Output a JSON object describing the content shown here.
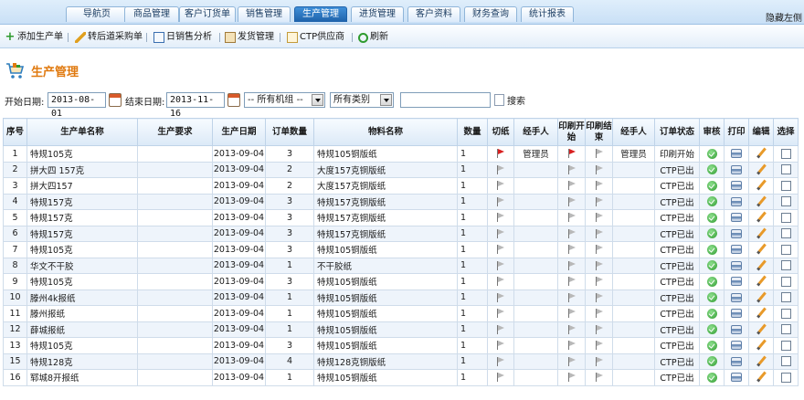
{
  "nav": {
    "tabs": [
      {
        "label": "导航页",
        "active": false
      },
      {
        "label": "商品管理",
        "active": false
      },
      {
        "label": "客户订货单",
        "active": false
      },
      {
        "label": "销售管理",
        "active": false
      },
      {
        "label": "生产管理",
        "active": true
      },
      {
        "label": "进货管理",
        "active": false
      },
      {
        "label": "客户资料",
        "active": false
      },
      {
        "label": "财务查询",
        "active": false
      },
      {
        "label": "统计报表",
        "active": false
      }
    ],
    "right_text": "隐藏左侧"
  },
  "toolbar": {
    "add_label": "添加生产单",
    "transfer_label": "转后道采购单",
    "daily_sales_label": "日销售分析",
    "shipping_label": "发货管理",
    "ctp_label": "CTP供应商",
    "refresh_label": "刷新"
  },
  "page_title": "生产管理",
  "filters": {
    "start_label": "开始日期:",
    "start_value": "2013-08-01",
    "end_label": "结束日期:",
    "end_value": "2013-11-16",
    "org_select": "-- 所有机组 --",
    "category_select": "所有类别",
    "search_value": "",
    "search_label": "搜索"
  },
  "table": {
    "headers": [
      "序号",
      "生产单名称",
      "生产要求",
      "生产日期",
      "订单数量",
      "物料名称",
      "数量",
      "切纸",
      "经手人",
      "印刷开始",
      "印刷结束",
      "经手人",
      "订单状态",
      "审核",
      "打印",
      "编辑",
      "选择"
    ],
    "rows": [
      {
        "no": "1",
        "name": "特规105克",
        "req": "",
        "date": "2013-09-04",
        "qty": "3",
        "material": "特规105铜版纸",
        "count": "1",
        "cut_flag": "red",
        "handler": "管理员",
        "print_start_flag": "red",
        "print_end_flag": "grey",
        "handler2": "管理员",
        "status": "印刷开始"
      },
      {
        "no": "2",
        "name": "拼大四 157克",
        "req": "",
        "date": "2013-09-04",
        "qty": "2",
        "material": "大度157克铜版纸",
        "count": "1",
        "cut_flag": "grey",
        "handler": "",
        "print_start_flag": "grey",
        "print_end_flag": "grey",
        "handler2": "",
        "status": "CTP已出"
      },
      {
        "no": "3",
        "name": "拼大四157",
        "req": "",
        "date": "2013-09-04",
        "qty": "2",
        "material": "大度157克铜版纸",
        "count": "1",
        "cut_flag": "grey",
        "handler": "",
        "print_start_flag": "grey",
        "print_end_flag": "grey",
        "handler2": "",
        "status": "CTP已出"
      },
      {
        "no": "4",
        "name": "特规157克",
        "req": "",
        "date": "2013-09-04",
        "qty": "3",
        "material": "特规157克铜版纸",
        "count": "1",
        "cut_flag": "grey",
        "handler": "",
        "print_start_flag": "grey",
        "print_end_flag": "grey",
        "handler2": "",
        "status": "CTP已出"
      },
      {
        "no": "5",
        "name": "特规157克",
        "req": "",
        "date": "2013-09-04",
        "qty": "3",
        "material": "特规157克铜版纸",
        "count": "1",
        "cut_flag": "grey",
        "handler": "",
        "print_start_flag": "grey",
        "print_end_flag": "grey",
        "handler2": "",
        "status": "CTP已出"
      },
      {
        "no": "6",
        "name": "特规157克",
        "req": "",
        "date": "2013-09-04",
        "qty": "3",
        "material": "特规157克铜版纸",
        "count": "1",
        "cut_flag": "grey",
        "handler": "",
        "print_start_flag": "grey",
        "print_end_flag": "grey",
        "handler2": "",
        "status": "CTP已出"
      },
      {
        "no": "7",
        "name": "特规105克",
        "req": "",
        "date": "2013-09-04",
        "qty": "3",
        "material": "特规105铜版纸",
        "count": "1",
        "cut_flag": "grey",
        "handler": "",
        "print_start_flag": "grey",
        "print_end_flag": "grey",
        "handler2": "",
        "status": "CTP已出"
      },
      {
        "no": "8",
        "name": "华文不干胶",
        "req": "",
        "date": "2013-09-04",
        "qty": "1",
        "material": "不干胶纸",
        "count": "1",
        "cut_flag": "grey",
        "handler": "",
        "print_start_flag": "grey",
        "print_end_flag": "grey",
        "handler2": "",
        "status": "CTP已出"
      },
      {
        "no": "9",
        "name": "特规105克",
        "req": "",
        "date": "2013-09-04",
        "qty": "3",
        "material": "特规105铜版纸",
        "count": "1",
        "cut_flag": "grey",
        "handler": "",
        "print_start_flag": "grey",
        "print_end_flag": "grey",
        "handler2": "",
        "status": "CTP已出"
      },
      {
        "no": "10",
        "name": "滕州4k报纸",
        "req": "",
        "date": "2013-09-04",
        "qty": "1",
        "material": "特规105铜版纸",
        "count": "1",
        "cut_flag": "grey",
        "handler": "",
        "print_start_flag": "grey",
        "print_end_flag": "grey",
        "handler2": "",
        "status": "CTP已出"
      },
      {
        "no": "11",
        "name": "滕州报纸",
        "req": "",
        "date": "2013-09-04",
        "qty": "1",
        "material": "特规105铜版纸",
        "count": "1",
        "cut_flag": "grey",
        "handler": "",
        "print_start_flag": "grey",
        "print_end_flag": "grey",
        "handler2": "",
        "status": "CTP已出"
      },
      {
        "no": "12",
        "name": "薛城报纸",
        "req": "",
        "date": "2013-09-04",
        "qty": "1",
        "material": "特规105铜版纸",
        "count": "1",
        "cut_flag": "grey",
        "handler": "",
        "print_start_flag": "grey",
        "print_end_flag": "grey",
        "handler2": "",
        "status": "CTP已出"
      },
      {
        "no": "13",
        "name": "特规105克",
        "req": "",
        "date": "2013-09-04",
        "qty": "3",
        "material": "特规105铜版纸",
        "count": "1",
        "cut_flag": "grey",
        "handler": "",
        "print_start_flag": "grey",
        "print_end_flag": "grey",
        "handler2": "",
        "status": "CTP已出"
      },
      {
        "no": "15",
        "name": "特规128克",
        "req": "",
        "date": "2013-09-04",
        "qty": "4",
        "material": "特规128克铜版纸",
        "count": "1",
        "cut_flag": "grey",
        "handler": "",
        "print_start_flag": "grey",
        "print_end_flag": "grey",
        "handler2": "",
        "status": "CTP已出"
      },
      {
        "no": "16",
        "name": "郓城8开报纸",
        "req": "",
        "date": "2013-09-04",
        "qty": "1",
        "material": "特规105铜版纸",
        "count": "1",
        "cut_flag": "grey",
        "handler": "",
        "print_start_flag": "grey",
        "print_end_flag": "grey",
        "handler2": "",
        "status": "CTP已出"
      }
    ]
  },
  "colors": {
    "title_orange": "#e07a10",
    "active_tab": "#1e62aa",
    "flag_red": "#d82020",
    "approve_green": "#2f9b2f"
  }
}
